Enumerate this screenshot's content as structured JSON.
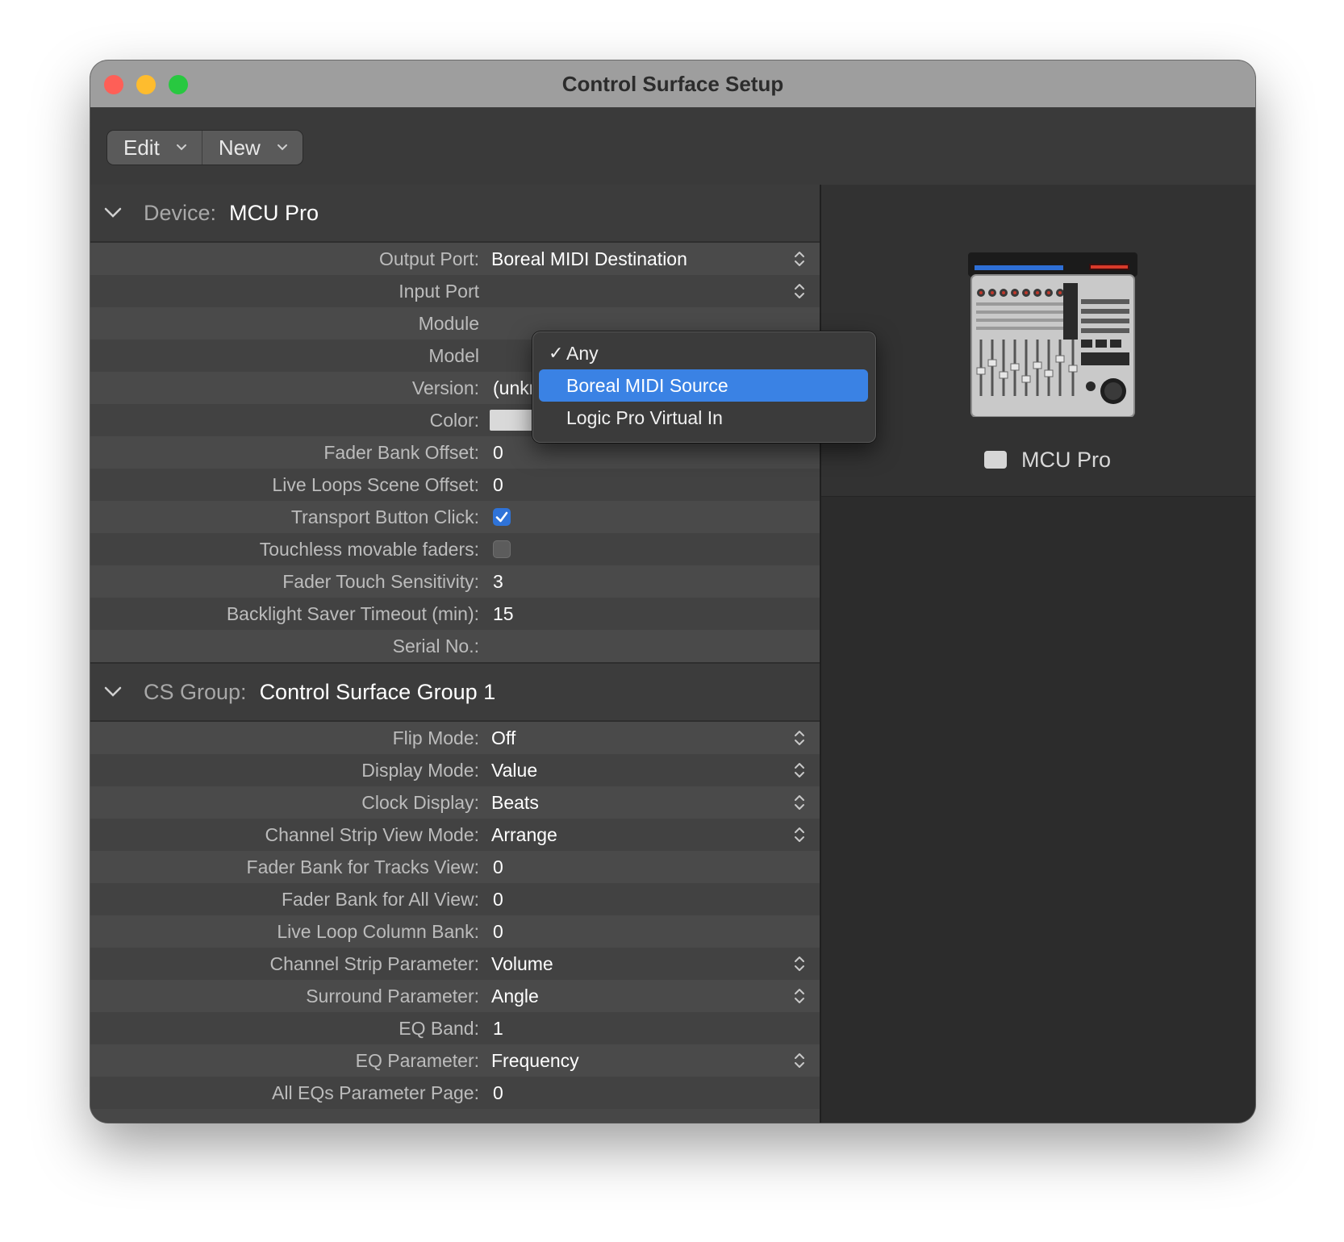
{
  "window": {
    "title": "Control Surface Setup"
  },
  "toolbar": {
    "edit_label": "Edit",
    "new_label": "New"
  },
  "device_section": {
    "label": "Device:",
    "value": "MCU Pro",
    "rows": [
      {
        "label": "Output Port:",
        "value": "Boreal MIDI Destination"
      },
      {
        "label": "Input Port",
        "value": ""
      },
      {
        "label": "Module",
        "value": ""
      },
      {
        "label": "Model",
        "value": ""
      },
      {
        "label": "Version:",
        "value": "(unknown)"
      },
      {
        "label": "Color:",
        "value": ""
      },
      {
        "label": "Fader Bank Offset:",
        "value": "0"
      },
      {
        "label": "Live Loops Scene Offset:",
        "value": "0"
      },
      {
        "label": "Transport Button Click:",
        "value": ""
      },
      {
        "label": "Touchless movable faders:",
        "value": ""
      },
      {
        "label": "Fader Touch Sensitivity:",
        "value": "3"
      },
      {
        "label": "Backlight Saver Timeout (min):",
        "value": "15"
      },
      {
        "label": "Serial No.:",
        "value": ""
      }
    ],
    "color_swatch": "#d9d9d9",
    "transport_button_click_checked": true,
    "touchless_faders_checked": false
  },
  "input_port_menu": {
    "items": [
      {
        "label": "Any",
        "checked": true,
        "highlighted": false
      },
      {
        "label": "Boreal MIDI Source",
        "checked": false,
        "highlighted": true
      },
      {
        "label": "Logic Pro Virtual In",
        "checked": false,
        "highlighted": false
      }
    ],
    "checkmark": "✓"
  },
  "cs_group_section": {
    "label": "CS Group:",
    "value": "Control Surface Group 1",
    "rows": [
      {
        "label": "Flip Mode:",
        "value": "Off"
      },
      {
        "label": "Display Mode:",
        "value": "Value"
      },
      {
        "label": "Clock Display:",
        "value": "Beats"
      },
      {
        "label": "Channel Strip View Mode:",
        "value": "Arrange"
      },
      {
        "label": "Fader Bank for Tracks View:",
        "value": "0"
      },
      {
        "label": "Fader Bank for All View:",
        "value": "0"
      },
      {
        "label": "Live Loop Column Bank:",
        "value": "0"
      },
      {
        "label": "Channel Strip Parameter:",
        "value": "Volume"
      },
      {
        "label": "Surround Parameter:",
        "value": "Angle"
      },
      {
        "label": "EQ Band:",
        "value": "1"
      },
      {
        "label": "EQ Parameter:",
        "value": "Frequency"
      },
      {
        "label": "All EQs Parameter Page:",
        "value": "0"
      }
    ]
  },
  "device_panel": {
    "device_name": "MCU Pro"
  },
  "icons": {
    "disclosure": "chevron-down-icon",
    "stepper": "up-down-stepper-icon",
    "menu_chevron": "chevron-down-icon"
  },
  "colors": {
    "accent": "#3a82e4",
    "close": "#fe5f57",
    "minimize": "#febc2e",
    "maximize": "#28c840"
  }
}
